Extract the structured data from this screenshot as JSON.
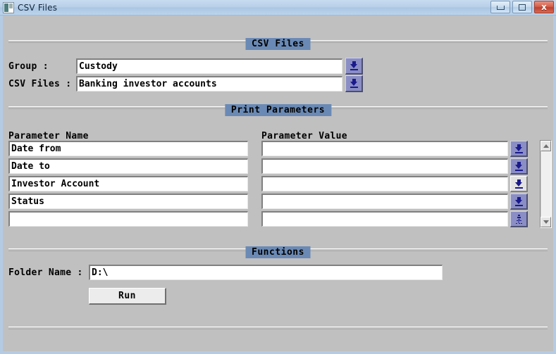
{
  "window": {
    "title": "CSV Files",
    "icon": "app-icon",
    "buttons": {
      "minimize": "—",
      "maximize": "□",
      "close": "x"
    }
  },
  "sections": {
    "csv_files": {
      "caption": "CSV Files"
    },
    "print_parameters": {
      "caption": "Print Parameters"
    },
    "functions": {
      "caption": "Functions"
    }
  },
  "csv_files": {
    "group_label": "Group :",
    "group_value": "Custody",
    "files_label": "CSV Files :",
    "files_value": "Banking investor accounts"
  },
  "print_parameters": {
    "name_header": "Parameter Name",
    "value_header": "Parameter Value",
    "rows": [
      {
        "name": "Date from",
        "value": "",
        "button": "dropdown-arrow"
      },
      {
        "name": "Date to",
        "value": "",
        "button": "dropdown-arrow"
      },
      {
        "name": "Investor Account",
        "value": "",
        "button": "dropdown-arrow"
      },
      {
        "name": "Status",
        "value": "",
        "button": "dropdown-arrow"
      },
      {
        "name": "",
        "value": "",
        "button": "dropdown-arrow-busy"
      }
    ]
  },
  "functions": {
    "folder_label": "Folder Name :",
    "folder_value": "D:\\",
    "run_label": "Run"
  },
  "colors": {
    "section_header_bg": "#6a8ab5",
    "dialog_bg": "#c0c0c0",
    "dropdown_btn_bg": "#8a8ec4",
    "dropdown_btn_light_bg": "#e2e2e2",
    "arrow_color": "#1a1a8c",
    "titlebar_bg": "#b7cfe8",
    "close_btn_bg": "#d4614b"
  }
}
